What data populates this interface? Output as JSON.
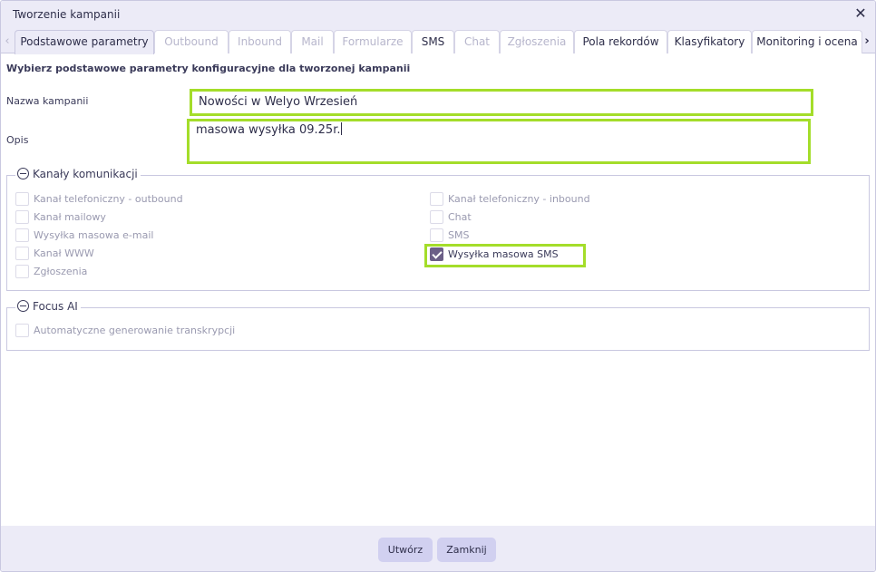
{
  "dialog": {
    "title": "Tworzenie kampanii"
  },
  "tabs": [
    {
      "label": "Podstawowe parametry",
      "state": "active"
    },
    {
      "label": "Outbound",
      "state": "disabled"
    },
    {
      "label": "Inbound",
      "state": "disabled"
    },
    {
      "label": "Mail",
      "state": "disabled"
    },
    {
      "label": "Formularze",
      "state": "disabled"
    },
    {
      "label": "SMS",
      "state": "enabled"
    },
    {
      "label": "Chat",
      "state": "disabled"
    },
    {
      "label": "Zgłoszenia",
      "state": "disabled"
    },
    {
      "label": "Pola rekordów",
      "state": "enabled"
    },
    {
      "label": "Klasyfikatory",
      "state": "enabled"
    },
    {
      "label": "Monitoring i ocena",
      "state": "enabled"
    }
  ],
  "form": {
    "heading": "Wybierz podstawowe parametry konfiguracyjne dla tworzonej kampanii",
    "name_label": "Nazwa kampanii",
    "name_value": "Nowości w Welyo Wrzesień",
    "desc_label": "Opis",
    "desc_value": "masowa wysyłka 09.25r."
  },
  "channels": {
    "legend": "Kanały komunikacji",
    "left": [
      {
        "label": "Kanał telefoniczny - outbound",
        "checked": false
      },
      {
        "label": "Kanał mailowy",
        "checked": false
      },
      {
        "label": "Wysyłka masowa e-mail",
        "checked": false
      },
      {
        "label": "Kanał WWW",
        "checked": false
      },
      {
        "label": "Zgłoszenia",
        "checked": false
      }
    ],
    "right": [
      {
        "label": "Kanał telefoniczny - inbound",
        "checked": false
      },
      {
        "label": "Chat",
        "checked": false
      },
      {
        "label": "SMS",
        "checked": false
      },
      {
        "label": "Wysyłka masowa SMS",
        "checked": true
      }
    ]
  },
  "focus_ai": {
    "legend": "Focus AI",
    "items": [
      {
        "label": "Automatyczne generowanie transkrypcji",
        "checked": false
      }
    ]
  },
  "buttons": {
    "create": "Utwórz",
    "close": "Zamknij"
  },
  "colors": {
    "highlight": "#a4dd2a",
    "accent": "#6b5f87",
    "button": "#d1d0f0",
    "panel": "#ecebf7"
  }
}
